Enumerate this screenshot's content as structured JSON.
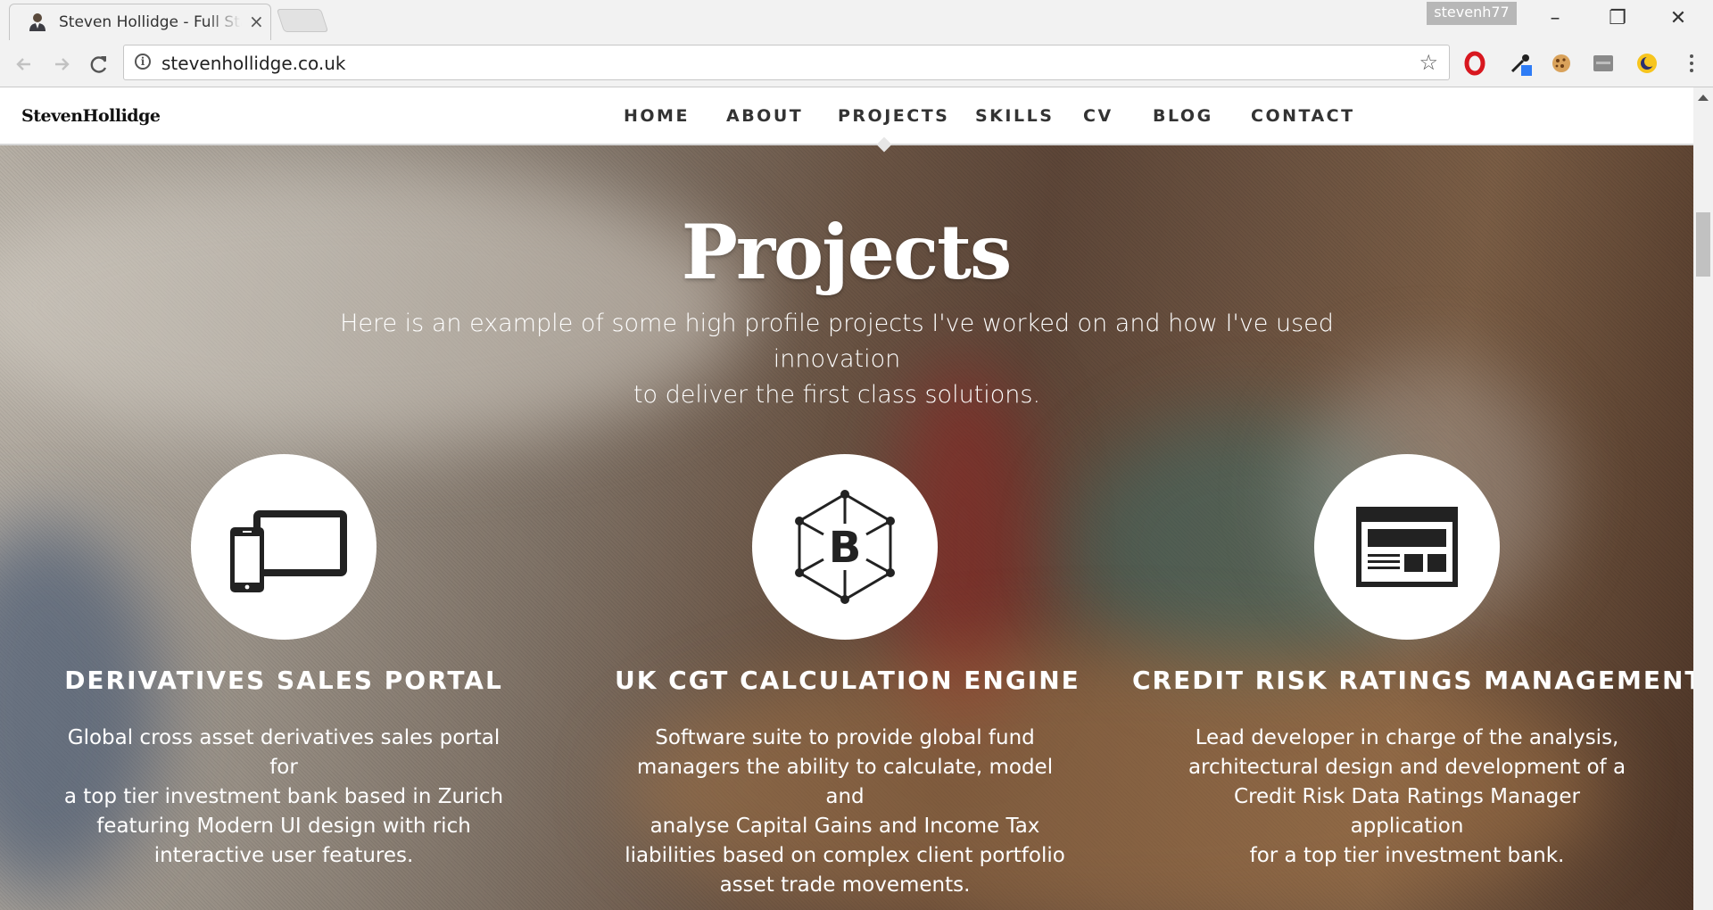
{
  "browser": {
    "tab_title": "Steven Hollidge - Full Sta",
    "tab_close": "×",
    "profile_name": "stevenh77",
    "address": "stevenhollidge.co.uk",
    "window_controls": {
      "minimize": "–",
      "restore": "❐",
      "close": "✕"
    }
  },
  "site": {
    "logo": "StevenHollidge",
    "nav": [
      "HOME",
      "ABOUT",
      "PROJECTS",
      "SKILLS",
      "CV",
      "BLOG",
      "CONTACT"
    ],
    "active_nav": "PROJECTS"
  },
  "hero": {
    "title": "Projects",
    "subtitle_line1": "Here is an example of some high profile projects I've worked on and how I've used innovation",
    "subtitle_line2": "to deliver the first class solutions."
  },
  "projects": [
    {
      "icon": "devices-icon",
      "title": "DERIVATIVES SALES PORTAL",
      "desc": [
        "Global cross asset derivatives sales portal for",
        "a top tier investment bank based in Zurich",
        "featuring Modern UI design with rich",
        "interactive user features."
      ]
    },
    {
      "icon": "bitcoin-hexagon-icon",
      "title": "UK CGT CALCULATION ENGINE",
      "desc": [
        "Software suite to provide global fund",
        "managers the ability to calculate, model and",
        "analyse Capital Gains and Income Tax",
        "liabilities based on complex client portfolio",
        "asset trade movements."
      ]
    },
    {
      "icon": "browser-layout-icon",
      "title": "CREDIT RISK RATINGS MANAGEMENT",
      "desc": [
        "Lead developer in charge of the analysis,",
        "architectural design and development of a",
        "Credit Risk Data Ratings Manager application",
        "for a top tier investment bank."
      ]
    }
  ]
}
